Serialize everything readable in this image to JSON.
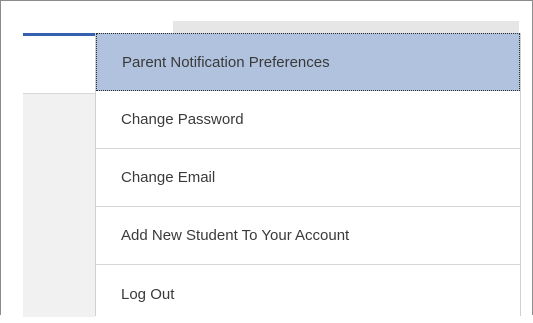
{
  "menu": {
    "items": [
      {
        "label": "Parent Notification Preferences",
        "active": true
      },
      {
        "label": "Change Password",
        "active": false
      },
      {
        "label": "Change Email",
        "active": false
      },
      {
        "label": "Add New Student To Your Account",
        "active": false
      },
      {
        "label": "Log Out",
        "active": false
      }
    ]
  },
  "colors": {
    "accent": "#3561ae",
    "active_item_background": "#b0c2de"
  }
}
